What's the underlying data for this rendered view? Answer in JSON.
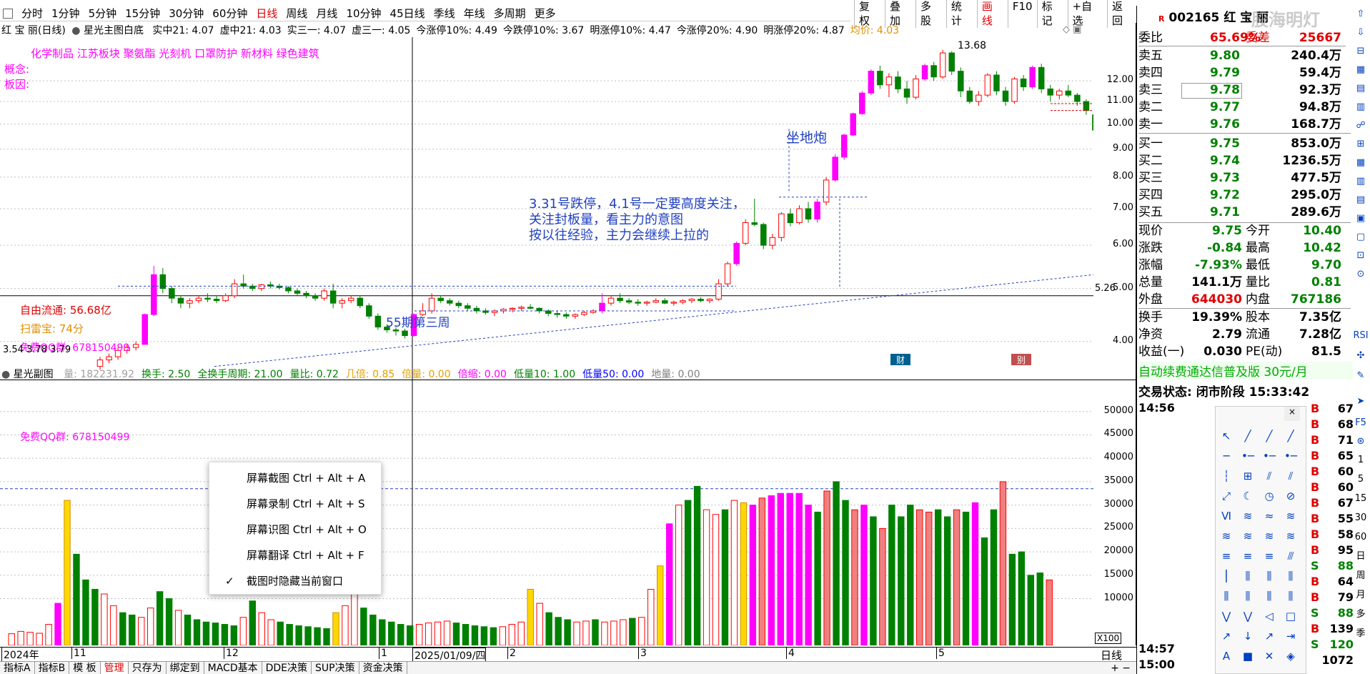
{
  "periods": [
    "分时",
    "1分钟",
    "5分钟",
    "15分钟",
    "30分钟",
    "60分钟",
    "日线",
    "周线",
    "月线",
    "10分钟",
    "45日线",
    "季线",
    "年线",
    "多周期",
    "更多"
  ],
  "active_period": "日线",
  "toolbar": [
    "复权",
    "叠加",
    "多股",
    "统计",
    "画线",
    "F10",
    "标记",
    "+自选",
    "返回"
  ],
  "stock": {
    "code": "002165",
    "name": "红 宝 丽"
  },
  "watermark": "股海明灯",
  "header_line": {
    "name": "红 宝 丽(日线)",
    "indicator": "星光主图白底",
    "items": [
      {
        "label": "实中21: 4.07",
        "color": "#000000"
      },
      {
        "label": "虚中21: 4.03",
        "color": "#000000"
      },
      {
        "label": "实三一: 4.07",
        "color": "#000000"
      },
      {
        "label": "虚三一: 4.05",
        "color": "#000000"
      },
      {
        "label": "今涨停10%: 4.49",
        "color": "#000000"
      },
      {
        "label": "今跌停10%: 3.67",
        "color": "#000000"
      },
      {
        "label": "明涨停10%: 4.47",
        "color": "#000000"
      },
      {
        "label": "今涨停20%: 4.90",
        "color": "#000000"
      },
      {
        "label": "明涨停20%: 4.87",
        "color": "#000000"
      },
      {
        "label": "均价: 4.03",
        "color": "#e09000"
      }
    ]
  },
  "concepts": "化学制品    江苏板块    聚氨酯 光刻机 口罩防护 新材料 绿色建筑",
  "concept_label": "概念:",
  "reason_label": "板因:",
  "float_cap": "自由流通: 56.68亿",
  "scan": "扫雷宝: 74分",
  "qq_main": "免费QQ群: 678150499",
  "low_price": "3.54",
  "low_extra": "3.78  3.79",
  "peak_label": "13.68",
  "label_5_26": "5.26",
  "annotation_didi": "坐地炮",
  "annotation_main": [
    "3.31号跌停，4.1号一定要高度关注，",
    "关注封板量，看主力的意图",
    "按以往经验，主力会继续上拉的"
  ],
  "annotation_55": "55期第三周",
  "price_ticks": [
    "12.00",
    "11.00",
    "10.00",
    "9.00",
    "8.00",
    "7.00",
    "6.00",
    "5.00",
    "4.00"
  ],
  "badges": {
    "cai": "财",
    "bie": "别"
  },
  "sub_header": {
    "name": "星光副图",
    "items": [
      {
        "label": "量: 182231.92",
        "color": "#a0a0a0"
      },
      {
        "label": "换手: 2.50",
        "color": "#008000"
      },
      {
        "label": "全换手周期: 21.00",
        "color": "#008000"
      },
      {
        "label": "量比: 0.72",
        "color": "#008000"
      },
      {
        "label": "几倍: 0.85",
        "color": "#e0a000"
      },
      {
        "label": "倍量: 0.00",
        "color": "#e0a000"
      },
      {
        "label": "倍缩: 0.00",
        "color": "#ff00ff"
      },
      {
        "label": "低量10: 1.00",
        "color": "#008000"
      },
      {
        "label": "低量50: 0.00",
        "color": "#0000ff"
      },
      {
        "label": "地量: 0.00",
        "color": "#808080"
      }
    ]
  },
  "qq_sub": "免费QQ群: 678150499",
  "vol_ticks": [
    "50000",
    "45000",
    "40000",
    "35000",
    "30000",
    "25000",
    "20000",
    "15000",
    "10000"
  ],
  "vol_unit": "X100",
  "dates": [
    {
      "label": "2024年",
      "boxed": false
    },
    {
      "label": "11",
      "boxed": false
    },
    {
      "label": "12",
      "boxed": false
    },
    {
      "label": "1",
      "boxed": false
    },
    {
      "label": "2025/01/09/四",
      "boxed": true
    },
    {
      "label": "2",
      "boxed": false
    },
    {
      "label": "3",
      "boxed": false
    },
    {
      "label": "4",
      "boxed": false
    },
    {
      "label": "5",
      "boxed": false
    }
  ],
  "period_label": "日线",
  "bottom_tabs": [
    "指标A",
    "指标B",
    "模 板",
    "管理",
    "只存为",
    "绑定到",
    "MACD基本",
    "DDE决策",
    "SUP决策",
    "资金决策"
  ],
  "context_menu": [
    {
      "label": "屏幕截图 Ctrl + Alt + A",
      "checked": false
    },
    {
      "label": "屏幕录制 Ctrl + Alt + S",
      "checked": false
    },
    {
      "label": "屏幕识图 Ctrl + Alt + O",
      "checked": false
    },
    {
      "label": "屏幕翻译 Ctrl + Alt + F",
      "checked": false
    },
    {
      "label": "截图时隐藏当前窗口",
      "checked": true
    }
  ],
  "quote": {
    "weibi_label": "委比",
    "weibi": "65.69%",
    "weicha_label": "委差",
    "weicha": "25667",
    "sells": [
      {
        "label": "卖五",
        "price": "9.80",
        "vol": "240.4万"
      },
      {
        "label": "卖四",
        "price": "9.79",
        "vol": "59.4万"
      },
      {
        "label": "卖三",
        "price": "9.78",
        "vol": "92.3万"
      },
      {
        "label": "卖二",
        "price": "9.77",
        "vol": "94.8万"
      },
      {
        "label": "卖一",
        "price": "9.76",
        "vol": "168.7万"
      }
    ],
    "buys": [
      {
        "label": "买一",
        "price": "9.75",
        "vol": "853.0万"
      },
      {
        "label": "买二",
        "price": "9.74",
        "vol": "1236.5万"
      },
      {
        "label": "买三",
        "price": "9.73",
        "vol": "477.5万"
      },
      {
        "label": "买四",
        "price": "9.72",
        "vol": "295.0万"
      },
      {
        "label": "买五",
        "price": "9.71",
        "vol": "289.6万"
      }
    ],
    "stats": [
      {
        "l1": "现价",
        "v1": "9.75",
        "c1": "#008000",
        "l2": "今开",
        "v2": "10.40",
        "c2": "#008000"
      },
      {
        "l1": "涨跌",
        "v1": "-0.84",
        "c1": "#008000",
        "l2": "最高",
        "v2": "10.42",
        "c2": "#008000"
      },
      {
        "l1": "涨幅",
        "v1": "-7.93%",
        "c1": "#008000",
        "l2": "最低",
        "v2": "9.70",
        "c2": "#008000"
      },
      {
        "l1": "总量",
        "v1": "141.1万",
        "c1": "#000000",
        "l2": "量比",
        "v2": "0.81",
        "c2": "#008000"
      },
      {
        "l1": "外盘",
        "v1": "644030",
        "c1": "#e00000",
        "l2": "内盘",
        "v2": "767186",
        "c2": "#008000"
      }
    ],
    "fund": [
      {
        "l1": "换手",
        "v1": "19.39%",
        "l2": "股本",
        "v2": "7.35亿"
      },
      {
        "l1": "净资",
        "v1": "2.79",
        "l2": "流通",
        "v2": "7.28亿"
      },
      {
        "l1": "收益(一)",
        "v1": "0.030",
        "l2": "PE(动)",
        "v2": "81.5"
      }
    ],
    "promo": "自动续费通达信普及版  30元/月",
    "trade_state": "交易状态: 闭市阶段 15:33:42"
  },
  "tick_times": [
    "14:56",
    "14:57",
    "15:00"
  ],
  "trades": [
    {
      "side": "B",
      "vol": "67"
    },
    {
      "side": "B",
      "vol": "68"
    },
    {
      "side": "B",
      "vol": "71"
    },
    {
      "side": "B",
      "vol": "65"
    },
    {
      "side": "B",
      "vol": "60"
    },
    {
      "side": "B",
      "vol": "60"
    },
    {
      "side": "B",
      "vol": "67"
    },
    {
      "side": "B",
      "vol": "55"
    },
    {
      "side": "B",
      "vol": "58"
    },
    {
      "side": "B",
      "vol": "95"
    },
    {
      "side": "S",
      "vol": "88"
    },
    {
      "side": "B",
      "vol": "64"
    },
    {
      "side": "B",
      "vol": "79"
    },
    {
      "side": "S",
      "vol": "88"
    },
    {
      "side": "B",
      "vol": "139"
    },
    {
      "side": "S",
      "vol": "120"
    },
    {
      "side": "",
      "vol": "1072"
    }
  ],
  "right_side_labels": [
    "1",
    "5",
    "15",
    "30",
    "60",
    "日",
    "周",
    "月",
    "多",
    "季"
  ],
  "colors": {
    "up": "#ff0000",
    "down": "#008000",
    "limit_up": "#ff00ff",
    "vol_up": "#f08080",
    "vol_gold": "#ffd700"
  },
  "chart_data": [
    {
      "type": "candlestick",
      "title": "红宝丽(日线)",
      "ylim": [
        3.5,
        14
      ],
      "candles": [
        [
          3.6,
          3.75,
          3.55,
          3.7
        ],
        [
          3.7,
          3.8,
          3.65,
          3.75
        ],
        [
          3.75,
          3.9,
          3.7,
          3.85
        ],
        [
          3.85,
          3.95,
          3.8,
          3.9
        ],
        [
          3.9,
          4.0,
          3.85,
          3.95
        ],
        [
          3.95,
          4.5,
          3.95,
          4.48
        ],
        [
          4.48,
          5.5,
          4.45,
          5.3
        ],
        [
          5.3,
          5.45,
          4.9,
          5.0
        ],
        [
          5.0,
          5.05,
          4.7,
          4.8
        ],
        [
          4.8,
          4.85,
          4.6,
          4.7
        ],
        [
          4.7,
          4.8,
          4.6,
          4.75
        ],
        [
          4.75,
          4.85,
          4.7,
          4.8
        ],
        [
          4.8,
          4.9,
          4.72,
          4.78
        ],
        [
          4.78,
          4.85,
          4.7,
          4.75
        ],
        [
          4.75,
          4.9,
          4.72,
          4.85
        ],
        [
          4.85,
          5.2,
          4.8,
          5.1
        ],
        [
          5.1,
          5.3,
          5.0,
          5.05
        ],
        [
          5.05,
          5.1,
          4.95,
          5.0
        ],
        [
          5.0,
          5.1,
          4.95,
          5.08
        ],
        [
          5.08,
          5.15,
          5.0,
          5.05
        ],
        [
          5.05,
          5.1,
          4.98,
          5.02
        ],
        [
          5.02,
          5.05,
          4.9,
          4.95
        ],
        [
          4.95,
          5.0,
          4.85,
          4.9
        ],
        [
          4.9,
          4.95,
          4.8,
          4.85
        ],
        [
          4.85,
          4.9,
          4.75,
          4.8
        ],
        [
          4.8,
          5.0,
          4.75,
          4.95
        ],
        [
          4.95,
          5.1,
          4.6,
          4.7
        ],
        [
          4.7,
          4.8,
          4.6,
          4.75
        ],
        [
          4.75,
          4.85,
          4.7,
          4.8
        ],
        [
          4.8,
          4.85,
          4.6,
          4.65
        ],
        [
          4.65,
          4.7,
          4.4,
          4.45
        ],
        [
          4.45,
          4.5,
          4.2,
          4.25
        ],
        [
          4.25,
          4.3,
          4.15,
          4.2
        ],
        [
          4.2,
          4.25,
          4.1,
          4.18
        ],
        [
          4.18,
          4.22,
          4.05,
          4.1
        ],
        [
          4.1,
          4.5,
          4.08,
          4.48
        ],
        [
          4.48,
          4.7,
          4.45,
          4.55
        ],
        [
          4.55,
          4.9,
          4.5,
          4.8
        ],
        [
          4.8,
          4.85,
          4.7,
          4.75
        ],
        [
          4.75,
          4.8,
          4.65,
          4.7
        ],
        [
          4.7,
          4.75,
          4.6,
          4.65
        ],
        [
          4.65,
          4.7,
          4.55,
          4.6
        ],
        [
          4.6,
          4.65,
          4.5,
          4.55
        ],
        [
          4.55,
          4.6,
          4.48,
          4.52
        ],
        [
          4.52,
          4.58,
          4.45,
          4.55
        ],
        [
          4.55,
          4.6,
          4.5,
          4.58
        ],
        [
          4.58,
          4.62,
          4.52,
          4.6
        ],
        [
          4.6,
          4.65,
          4.55,
          4.62
        ],
        [
          4.62,
          4.68,
          4.58,
          4.6
        ],
        [
          4.6,
          4.62,
          4.5,
          4.55
        ],
        [
          4.55,
          4.58,
          4.45,
          4.5
        ],
        [
          4.5,
          4.55,
          4.42,
          4.48
        ],
        [
          4.48,
          4.52,
          4.4,
          4.45
        ],
        [
          4.45,
          4.5,
          4.4,
          4.48
        ],
        [
          4.48,
          4.55,
          4.45,
          4.52
        ],
        [
          4.52,
          4.58,
          4.5,
          4.55
        ],
        [
          4.55,
          4.9,
          4.5,
          4.7
        ],
        [
          4.7,
          4.85,
          4.65,
          4.8
        ],
        [
          4.8,
          4.9,
          4.7,
          4.75
        ],
        [
          4.75,
          4.8,
          4.68,
          4.72
        ],
        [
          4.72,
          4.78,
          4.65,
          4.7
        ],
        [
          4.7,
          4.75,
          4.65,
          4.72
        ],
        [
          4.72,
          4.8,
          4.7,
          4.75
        ],
        [
          4.75,
          4.8,
          4.68,
          4.7
        ],
        [
          4.7,
          4.75,
          4.65,
          4.72
        ],
        [
          4.72,
          4.78,
          4.68,
          4.75
        ],
        [
          4.75,
          4.8,
          4.7,
          4.78
        ],
        [
          4.78,
          4.82,
          4.72,
          4.75
        ],
        [
          4.75,
          4.8,
          4.7,
          4.78
        ],
        [
          4.78,
          5.2,
          4.75,
          5.1
        ],
        [
          5.1,
          5.6,
          5.05,
          5.55
        ],
        [
          5.55,
          6.1,
          5.5,
          6.05
        ],
        [
          6.05,
          6.7,
          6.0,
          6.6
        ],
        [
          6.6,
          7.3,
          6.5,
          6.55
        ],
        [
          6.55,
          6.6,
          5.9,
          6.0
        ],
        [
          6.0,
          6.3,
          5.9,
          6.2
        ],
        [
          6.2,
          6.9,
          6.1,
          6.85
        ],
        [
          6.85,
          7.0,
          6.5,
          6.6
        ],
        [
          6.6,
          7.1,
          6.55,
          7.0
        ],
        [
          7.0,
          7.2,
          6.6,
          6.7
        ],
        [
          6.7,
          7.3,
          6.6,
          7.2
        ],
        [
          7.2,
          8.0,
          7.1,
          7.9
        ],
        [
          7.9,
          8.8,
          7.85,
          8.7
        ],
        [
          8.7,
          9.6,
          8.6,
          9.55
        ],
        [
          9.55,
          10.5,
          9.5,
          10.45
        ],
        [
          10.45,
          11.5,
          10.4,
          11.4
        ],
        [
          11.4,
          12.6,
          11.3,
          12.5
        ],
        [
          12.5,
          12.8,
          11.6,
          11.8
        ],
        [
          11.8,
          12.4,
          11.2,
          12.2
        ],
        [
          12.2,
          12.5,
          11.4,
          11.6
        ],
        [
          11.6,
          12.0,
          10.9,
          11.2
        ],
        [
          11.2,
          12.3,
          11.1,
          12.1
        ],
        [
          12.1,
          12.9,
          12.0,
          12.8
        ],
        [
          12.8,
          13.0,
          12.0,
          12.2
        ],
        [
          12.2,
          13.68,
          12.1,
          13.5
        ],
        [
          13.5,
          13.6,
          12.3,
          12.5
        ],
        [
          12.5,
          12.7,
          11.2,
          11.5
        ],
        [
          11.5,
          11.7,
          10.9,
          11.0
        ],
        [
          11.0,
          11.5,
          10.8,
          11.3
        ],
        [
          11.3,
          12.4,
          11.2,
          12.3
        ],
        [
          12.3,
          12.5,
          11.3,
          11.5
        ],
        [
          11.5,
          11.7,
          10.8,
          11.0
        ],
        [
          11.0,
          12.2,
          10.9,
          12.1
        ],
        [
          12.1,
          12.3,
          11.5,
          11.7
        ],
        [
          11.7,
          12.8,
          11.6,
          12.7
        ],
        [
          12.7,
          12.9,
          11.4,
          11.6
        ],
        [
          11.6,
          11.8,
          11.0,
          11.3
        ],
        [
          11.3,
          11.6,
          11.1,
          11.5
        ],
        [
          11.5,
          11.8,
          11.2,
          11.3
        ],
        [
          11.3,
          11.4,
          10.8,
          11.0
        ],
        [
          11.0,
          11.1,
          10.4,
          10.59
        ],
        [
          10.4,
          10.42,
          9.7,
          9.75
        ]
      ]
    },
    {
      "type": "bar",
      "title": "星光副图",
      "ylim": [
        0,
        55000
      ],
      "values": [
        2500,
        3000,
        2800,
        2600,
        4500,
        9000,
        31000,
        19500,
        14000,
        12000,
        11000,
        8500,
        7000,
        6500,
        6000,
        8000,
        11500,
        10000,
        7500,
        6500,
        5500,
        5000,
        4800,
        4500,
        4200,
        6000,
        9500,
        7000,
        5500,
        5000,
        4500,
        4200,
        4000,
        3800,
        3600,
        7000,
        8500,
        12000,
        8000,
        6500,
        5500,
        5000,
        4500,
        4200,
        4500,
        4800,
        5000,
        5200,
        4800,
        4500,
        4200,
        4000,
        3800,
        4000,
        4500,
        5000,
        12000,
        9000,
        7000,
        6000,
        5500,
        5000,
        5200,
        5500,
        5000,
        5200,
        5500,
        5800,
        6000,
        12000,
        17000,
        26000,
        30000,
        31000,
        34000,
        29000,
        28000,
        29000,
        31000,
        30500,
        30000,
        31500,
        32000,
        32500,
        32500,
        32500,
        30000,
        28500,
        33000,
        35000,
        31000,
        29000,
        30000,
        27500,
        25000,
        30000,
        27500,
        30000,
        29000,
        28500,
        29000,
        27500,
        29000,
        28500,
        30500,
        23000,
        29000,
        35000,
        19500,
        20000,
        15000,
        15500,
        14000
      ]
    }
  ]
}
